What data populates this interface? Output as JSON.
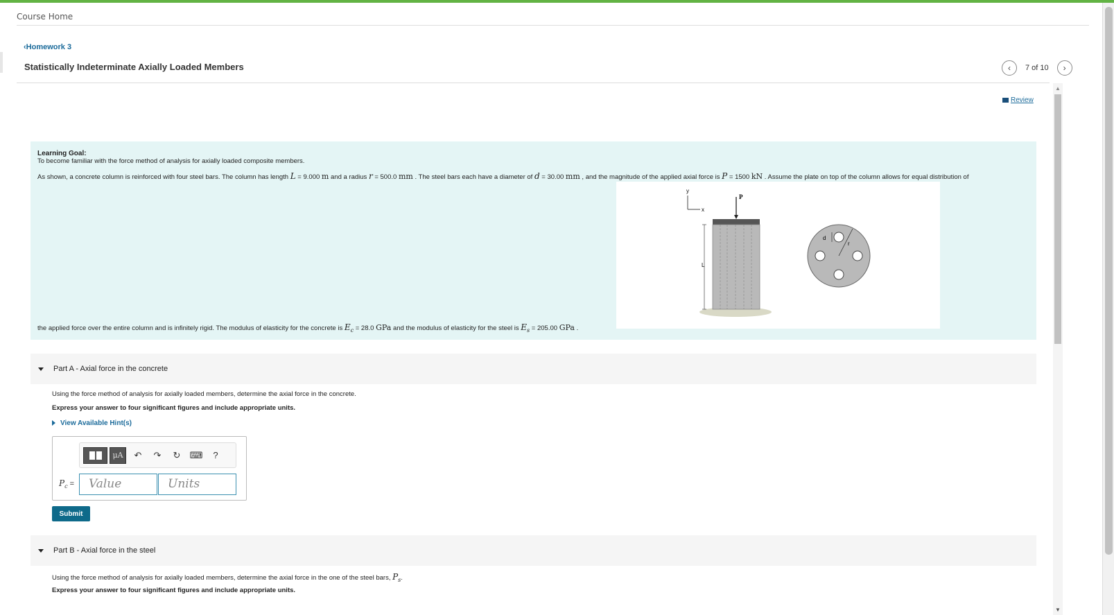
{
  "header": {
    "course_home": "Course Home",
    "back_link": "Homework 3",
    "title": "Statistically Indeterminate Axially Loaded Members",
    "pager": {
      "position": "7 of 10"
    },
    "review": "Review"
  },
  "problem": {
    "learning_goal_label": "Learning Goal:",
    "learning_goal_text": "To become familiar with the force method of analysis for axially loaded composite members.",
    "para1": {
      "a": "As shown, a concrete column is reinforced with four steel bars. The column has length ",
      "L_var": "L",
      "L_val": " = 9.000 ",
      "L_unit": "m",
      "b": " and a radius ",
      "r_var": "r",
      "r_val": " = 500.0 ",
      "r_unit": "mm",
      "c": " . The steel bars each have a diameter of ",
      "d_var": "d",
      "d_val": " = 30.00 ",
      "d_unit": "mm",
      "e": " , and the magnitude of the applied axial force is ",
      "P_var": "P",
      "P_val": " = 1500 ",
      "P_unit": "kN",
      "f": " . Assume the plate on top of the column allows for equal distribution of"
    },
    "para2": {
      "a": "the applied force over the entire column and is infinitely rigid. The modulus of elasticity for the concrete is ",
      "Ec_var": "E",
      "Ec_sub": "c",
      "Ec_val": " = 28.0 ",
      "Ec_unit": "GPa",
      "b": " and the modulus of elasticity for the steel is ",
      "Es_var": "E",
      "Es_sub": "s",
      "Es_val": " = 205.00 ",
      "Es_unit": "GPa",
      "c": " ."
    },
    "figure": {
      "axis_y": "y",
      "axis_x": "x",
      "force": "P",
      "length": "L",
      "diameter": "d",
      "radius": "r"
    }
  },
  "partA": {
    "label": "Part A",
    "name": "Axial force in the concrete",
    "instruction": "Using the force method of analysis for axially loaded members, determine the axial force in the concrete.",
    "express": "Express your answer to four significant figures and include appropriate units.",
    "hint": "View Available Hint(s)",
    "answer_label_var": "P",
    "answer_label_sub": "c",
    "answer_label_eq": " =",
    "value_placeholder": "Value",
    "units_placeholder": "Units",
    "toolbar": {
      "mu_label": "μA",
      "help": "?"
    },
    "submit": "Submit"
  },
  "partB": {
    "label": "Part B",
    "name": "Axial force in the steel",
    "instruction": "Using the force method of analysis for axially loaded members, determine the axial force in the one of the steel bars, ",
    "instruction_var": "P",
    "instruction_sub": "s",
    "instruction_end": ".",
    "express": "Express your answer to four significant figures and include appropriate units."
  },
  "colors": {
    "accent_green": "#62b344",
    "link_blue": "#1a6a9a",
    "panel_teal": "#e4f5f5",
    "submit_blue": "#0e6a8a"
  }
}
